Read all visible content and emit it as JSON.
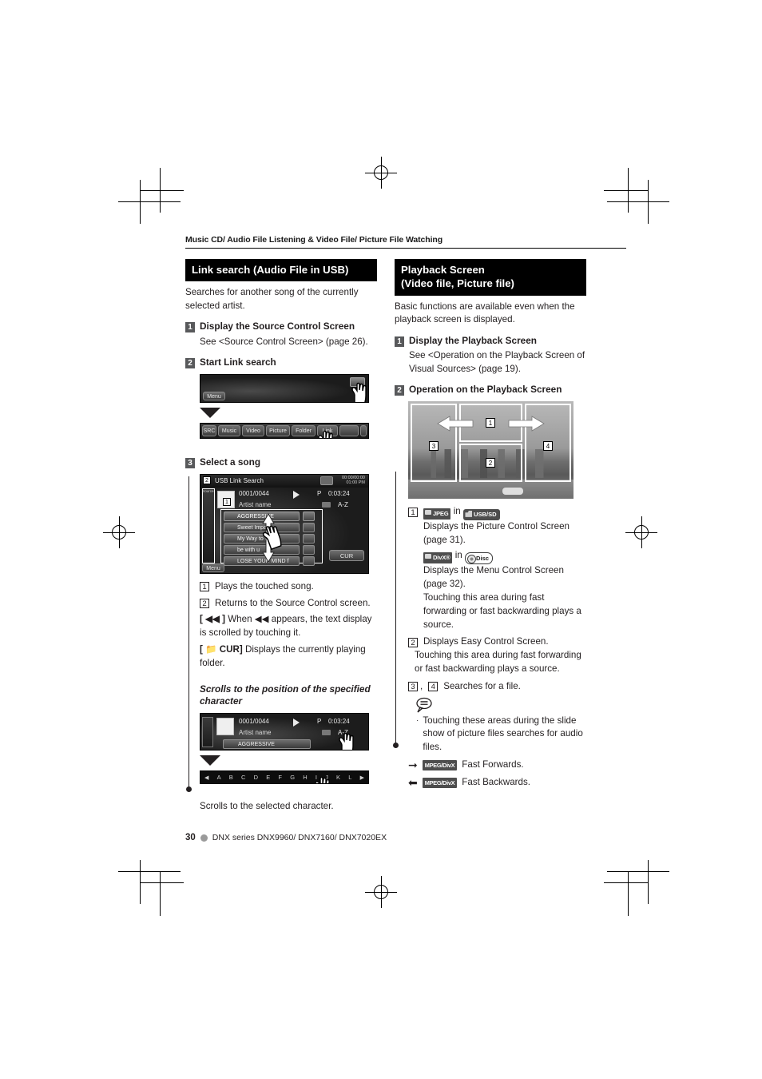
{
  "page": {
    "running_head": "Music CD/ Audio File Listening & Video File/ Picture File Watching",
    "footer_page_number": "30",
    "footer_text": "DNX series   DNX9960/ DNX7160/ DNX7020EX"
  },
  "left_column": {
    "section_title": "Link search (Audio File in USB)",
    "intro": "Searches for another song of the currently selected artist.",
    "steps": [
      {
        "num": "1",
        "title": "Display the Source Control Screen",
        "body": "See <Source Control Screen> (page 26)."
      },
      {
        "num": "2",
        "title": "Start Link search"
      },
      {
        "num": "3",
        "title": "Select a song"
      }
    ],
    "menu_bar": {
      "items": [
        "Music",
        "Video",
        "Picture",
        "Folder",
        "Link"
      ],
      "left_label": "SRC",
      "menu_label": "Menu"
    },
    "link_search_shot": {
      "title": "USB Link Search",
      "track_counter": "0001/0044",
      "play_glyph": "play-icon",
      "repeat_label": "P",
      "elapsed_time": "0:03:24",
      "clock": "00:00/00:00",
      "clock2": "01:00 PM",
      "source_label": "Source",
      "field_label": "Artist name",
      "sort_label": "A-Z",
      "cur_label": "CUR",
      "menu_label": "Menu",
      "callout_1": "1",
      "callout_2": "2",
      "songs": [
        "AGGRESSIVE",
        "Sweet Impact",
        "My Way to my fe",
        "be with u",
        "LOSE YOUR MIND f"
      ]
    },
    "legend": [
      {
        "num": "1",
        "text": "Plays the touched song."
      },
      {
        "num": "2",
        "text": "Returns to the Source Control screen."
      }
    ],
    "bracket_items": [
      {
        "key": "[ ◀◀ ]",
        "text": "When  ◀◀  appears, the text display is scrolled by touching it."
      },
      {
        "key": "[ 📁 CUR]",
        "text": "Displays the currently playing folder."
      }
    ],
    "scroll_subhead": "Scrolls to the position of the specified character",
    "scroll_shot": {
      "track_counter": "0001/0044",
      "repeat_label": "P",
      "elapsed_time": "0:03:24",
      "field_label": "Artist name",
      "sort_label": "A-Z",
      "song_row": "AGGRESSIVE"
    },
    "alphabet_bar": {
      "prev": "◀",
      "next": "▶",
      "letters": [
        "A",
        "B",
        "C",
        "D",
        "E",
        "F",
        "G",
        "H",
        "I",
        "J",
        "K",
        "L"
      ]
    },
    "scroll_caption": "Scrolls to the selected character."
  },
  "right_column": {
    "section_title_line1": "Playback Screen",
    "section_title_line2": "(Video file, Picture file)",
    "intro": "Basic functions are available even when the playback screen is displayed.",
    "steps": [
      {
        "num": "1",
        "title": "Display the Playback Screen",
        "body": "See <Operation on the Playback Screen of Visual Sources> (page 19)."
      },
      {
        "num": "2",
        "title": "Operation on the Playback Screen"
      }
    ],
    "playback_shot": {
      "zone_1": "1",
      "zone_2": "2",
      "zone_3": "3",
      "zone_4": "4",
      "left_arrow": "left-arrow-icon",
      "right_arrow": "right-arrow-icon"
    },
    "legend": {
      "item1_num": "1",
      "item1_badge_jpeg": "JPEG",
      "item1_in": "in",
      "item1_badge_usbsd": "USB/SD",
      "item1_text_a": "Displays the Picture Control Screen (page 31).",
      "item1_badge_divx": "DivX®",
      "item1_in2": "in",
      "item1_badge_disc": "Disc",
      "item1_text_b": "Displays the Menu Control Screen (page 32).",
      "item1_text_c": "Touching this area during fast forwarding or fast backwarding plays a source.",
      "item2_num": "2",
      "item2_text_a": "Displays Easy Control Screen.",
      "item2_text_b": "Touching this area during fast forwarding or fast backwarding plays a source.",
      "item34_num_a": "3",
      "item34_comma": ",",
      "item34_num_b": "4",
      "item34_text": "Searches for a file.",
      "note_bullet": "Touching these areas during the slide show of picture files searches for audio files.",
      "ff_badge": "MPEG/DivX",
      "ff_text": "Fast Forwards.",
      "fb_badge": "MPEG/DivX",
      "fb_text": "Fast Backwards."
    }
  },
  "colors": {
    "section_header_bg": "#000000",
    "section_header_fg": "#ffffff",
    "body_text": "#231f20",
    "step_num_bg": "#58595b"
  }
}
